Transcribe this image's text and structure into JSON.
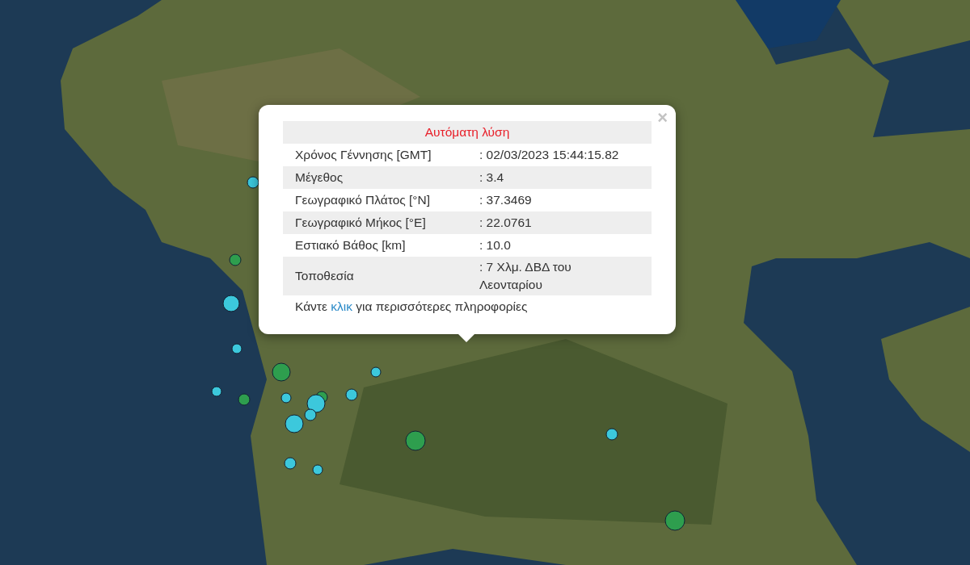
{
  "popup": {
    "title": "Αυτόματη λύση",
    "close": "×",
    "rows": [
      {
        "label": "Χρόνος Γέννησης [GMT]",
        "value": ": 02/03/2023 15:44:15.82"
      },
      {
        "label": "Μέγεθος",
        "value": ": 3.4"
      },
      {
        "label": "Γεωγραφικό Πλάτος [°N]",
        "value": ": 37.3469"
      },
      {
        "label": "Γεωγραφικό Μήκος [°E]",
        "value": ": 22.0761"
      },
      {
        "label": "Εστιακό Βάθος [km]",
        "value": ": 10.0"
      },
      {
        "label": "Τοποθεσία",
        "value": ": 7 Χλμ. ΔΒΔ του Λεονταρίου"
      }
    ],
    "footer": {
      "before": "Κάντε",
      "link": "κλικ",
      "after": "για περισσότερες πληροφορίες"
    }
  },
  "markers": [
    {
      "color": "#3cc8dc"
    },
    {
      "color": "#2e9e4e"
    },
    {
      "color": "#3cc8dc"
    },
    {
      "color": "#3cc8dc"
    },
    {
      "color": "#2e9e4e"
    },
    {
      "color": "#3cc8dc"
    },
    {
      "color": "#3cc8dc"
    },
    {
      "color": "#2e9e4e"
    },
    {
      "color": "#3cc8dc"
    },
    {
      "color": "#2e9e4e"
    },
    {
      "color": "#3cc8dc"
    },
    {
      "color": "#3cc8dc"
    },
    {
      "color": "#3cc8dc"
    },
    {
      "color": "#3cc8dc"
    },
    {
      "color": "#2e9e4e"
    },
    {
      "color": "#3cc8dc"
    },
    {
      "color": "#3cc8dc"
    },
    {
      "color": "#3cc8dc"
    },
    {
      "color": "#2e9e4e"
    }
  ]
}
